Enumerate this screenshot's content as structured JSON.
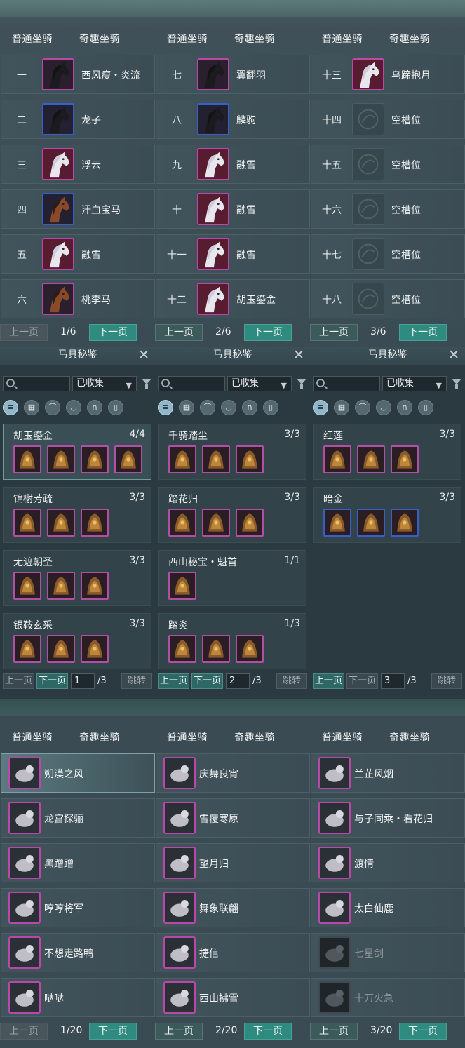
{
  "mount_pages": [
    {
      "tabs": [
        "普通坐骑",
        "奇趣坐骑"
      ],
      "rows": [
        {
          "num": "一",
          "name": "西风瘦・炎流",
          "frame": "purple",
          "icon": "black-horse-icon"
        },
        {
          "num": "二",
          "name": "龙子",
          "frame": "blue",
          "icon": "black-horse-icon"
        },
        {
          "num": "三",
          "name": "浮云",
          "frame": "purple",
          "icon": "white-horse-icon"
        },
        {
          "num": "四",
          "name": "汗血宝马",
          "frame": "blue",
          "icon": "brown-horse-icon"
        },
        {
          "num": "五",
          "name": "融雪",
          "frame": "purple",
          "icon": "white-horse-icon"
        },
        {
          "num": "六",
          "name": "桃李马",
          "frame": "teal",
          "icon": "brown-horse-icon"
        }
      ],
      "prev": "上一页",
      "page": "1/6",
      "next": "下一页",
      "prev_disabled": true
    },
    {
      "tabs": [
        "普通坐骑",
        "奇趣坐骑"
      ],
      "rows": [
        {
          "num": "七",
          "name": "翼翻羽",
          "frame": "purple",
          "icon": "black-horse-icon"
        },
        {
          "num": "八",
          "name": "麟驹",
          "frame": "blue",
          "icon": "black-horse-icon"
        },
        {
          "num": "九",
          "name": "融雪",
          "frame": "purple",
          "icon": "white-horse-icon"
        },
        {
          "num": "十",
          "name": "融雪",
          "frame": "purple",
          "icon": "white-horse-icon"
        },
        {
          "num": "十一",
          "name": "融雪",
          "frame": "purple",
          "icon": "white-horse-icon"
        },
        {
          "num": "十二",
          "name": "胡玉鎏金",
          "frame": "purple",
          "icon": "white-horse-icon"
        }
      ],
      "prev": "上一页",
      "page": "2/6",
      "next": "下一页",
      "prev_disabled": false
    },
    {
      "tabs": [
        "普通坐骑",
        "奇趣坐骑"
      ],
      "rows": [
        {
          "num": "十三",
          "name": "乌蹄抱月",
          "frame": "purple",
          "icon": "white-horse-icon"
        },
        {
          "num": "十四",
          "name": "空槽位",
          "frame": "empty",
          "icon": "empty-slot-icon"
        },
        {
          "num": "十五",
          "name": "空槽位",
          "frame": "empty",
          "icon": "empty-slot-icon"
        },
        {
          "num": "十六",
          "name": "空槽位",
          "frame": "empty",
          "icon": "empty-slot-icon"
        },
        {
          "num": "十七",
          "name": "空槽位",
          "frame": "empty",
          "icon": "empty-slot-icon"
        },
        {
          "num": "十八",
          "name": "空槽位",
          "frame": "empty",
          "icon": "empty-slot-icon"
        }
      ],
      "prev": "上一页",
      "page": "3/6",
      "next": "下一页",
      "prev_disabled": false
    }
  ],
  "collection_pages": [
    {
      "title": "马具秘鉴",
      "filter": "已收集",
      "sets": [
        {
          "name": "胡玉鎏金",
          "count": "4/4",
          "items": [
            "purple",
            "purple",
            "purple",
            "purple"
          ]
        },
        {
          "name": "锦榭芳疏",
          "count": "3/3",
          "items": [
            "purple",
            "purple",
            "purple"
          ]
        },
        {
          "name": "无遮朝圣",
          "count": "3/3",
          "items": [
            "purple",
            "purple",
            "purple"
          ]
        },
        {
          "name": "银鞍玄采",
          "count": "3/3",
          "items": [
            "purple",
            "purple",
            "purple"
          ]
        }
      ],
      "prev": "上一页",
      "next": "下一页",
      "page": "1",
      "total": "/3",
      "jump": "跳转"
    },
    {
      "title": "马具秘鉴",
      "filter": "已收集",
      "sets": [
        {
          "name": "千骑踏尘",
          "count": "3/3",
          "items": [
            "purple",
            "purple",
            "purple"
          ]
        },
        {
          "name": "踏花归",
          "count": "3/3",
          "items": [
            "purple",
            "purple",
            "purple"
          ]
        },
        {
          "name": "西山秘宝・魁首",
          "count": "1/1",
          "items": [
            "purple"
          ]
        },
        {
          "name": "踏炎",
          "count": "1/3",
          "items": [
            "purple",
            "purple",
            "purple"
          ]
        }
      ],
      "prev": "上一页",
      "next": "下一页",
      "page": "2",
      "total": "/3",
      "jump": "跳转"
    },
    {
      "title": "马具秘鉴",
      "filter": "已收集",
      "sets": [
        {
          "name": "红莲",
          "count": "3/3",
          "items": [
            "purple",
            "purple",
            "purple"
          ]
        },
        {
          "name": "暗金",
          "count": "3/3",
          "items": [
            "blue",
            "blue",
            "blue"
          ]
        }
      ],
      "prev": "上一页",
      "next": "下一页",
      "page": "3",
      "total": "/3",
      "jump": "跳转"
    }
  ],
  "fun_pages": [
    {
      "tabs": [
        "普通坐骑",
        "奇趣坐骑"
      ],
      "rows": [
        {
          "name": "朔漠之风",
          "icon": "carriage-icon"
        },
        {
          "name": "龙宫探骊",
          "icon": "cloud-icon"
        },
        {
          "name": "黑蹭蹭",
          "icon": "beast-icon"
        },
        {
          "name": "哼哼将军",
          "icon": "pig-icon"
        },
        {
          "name": "不想走路鸭",
          "icon": "duck-icon"
        },
        {
          "name": "哒哒",
          "icon": "creature-icon"
        }
      ],
      "prev": "上一页",
      "page": "1/20",
      "next": "下一页"
    },
    {
      "tabs": [
        "普通坐骑",
        "奇趣坐骑"
      ],
      "rows": [
        {
          "name": "庆舞良宵",
          "icon": "lion-dance-icon"
        },
        {
          "name": "雪覆寒原",
          "icon": "white-deer-icon"
        },
        {
          "name": "望月归",
          "icon": "crane-icon"
        },
        {
          "name": "舞象联翩",
          "icon": "elephant-icon"
        },
        {
          "name": "捷信",
          "icon": "white-elephant-icon"
        },
        {
          "name": "西山拂雪",
          "icon": "white-deer-icon"
        }
      ],
      "prev": "上一页",
      "page": "2/20",
      "next": "下一页"
    },
    {
      "tabs": [
        "普通坐骑",
        "奇趣坐骑"
      ],
      "rows": [
        {
          "name": "兰芷风烟",
          "icon": "cart-icon"
        },
        {
          "name": "与子同乘・看花归",
          "icon": "horse-tree-icon"
        },
        {
          "name": "渡情",
          "icon": "raft-icon"
        },
        {
          "name": "太白仙鹿",
          "icon": "antler-icon"
        },
        {
          "name": "七星剑",
          "icon": "sword-icon",
          "dim": true
        },
        {
          "name": "十万火急",
          "icon": "orb-icon",
          "dim": true
        }
      ],
      "prev": "上一页",
      "page": "3/20",
      "next": "下一页"
    }
  ],
  "colors": {
    "purple_frame": "#b949a8",
    "blue_frame": "#3a5ec8",
    "next_button": "#2f8a7f",
    "panel_bg": "#3a4b53"
  }
}
